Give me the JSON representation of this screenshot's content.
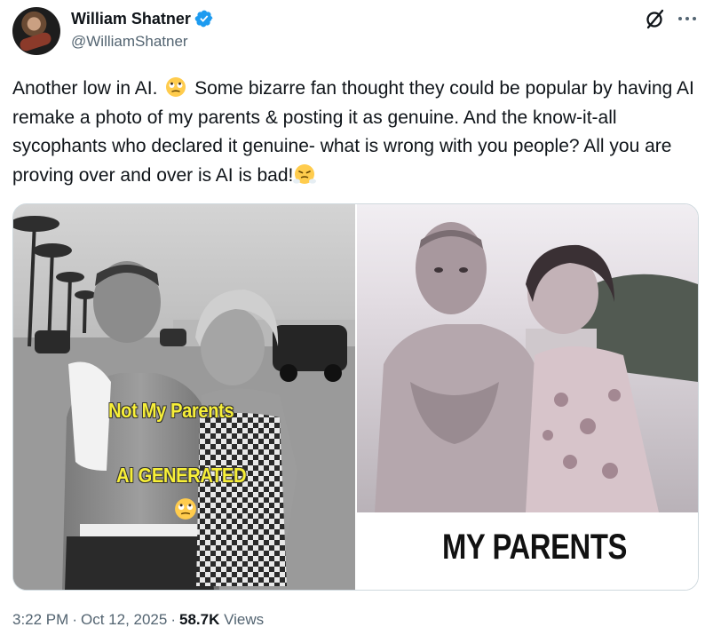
{
  "author": {
    "display_name": "William Shatner",
    "handle": "@WilliamShatner",
    "verified": true
  },
  "tweet": {
    "text_part1": "Another low in AI.",
    "emoji1": "face-with-rolling-eyes",
    "text_part2": "Some bizarre fan thought they could be popular by having AI remake a photo of my parents & posting it as genuine. And the know-it-all sycophants who declared it genuine- what is wrong with you people? All you are proving over and over is AI is bad!",
    "emoji2": "face-with-steam-from-nose"
  },
  "media": {
    "left_caption_1": "Not My Parents",
    "left_caption_2": "AI  GENERATED",
    "left_caption_emoji": "face-with-rolling-eyes",
    "right_caption": "MY PARENTS"
  },
  "meta": {
    "time": "3:22 PM",
    "date": "Oct 12, 2025",
    "views_count": "58.7K",
    "views_label": "Views"
  },
  "icons": {
    "grok": "grok-icon",
    "more": "more-icon",
    "verified": "verified-badge-icon"
  },
  "colors": {
    "text": "#0f1419",
    "secondary": "#536471",
    "verified_blue": "#1d9bf0",
    "caption_yellow": "#f7ef38"
  }
}
